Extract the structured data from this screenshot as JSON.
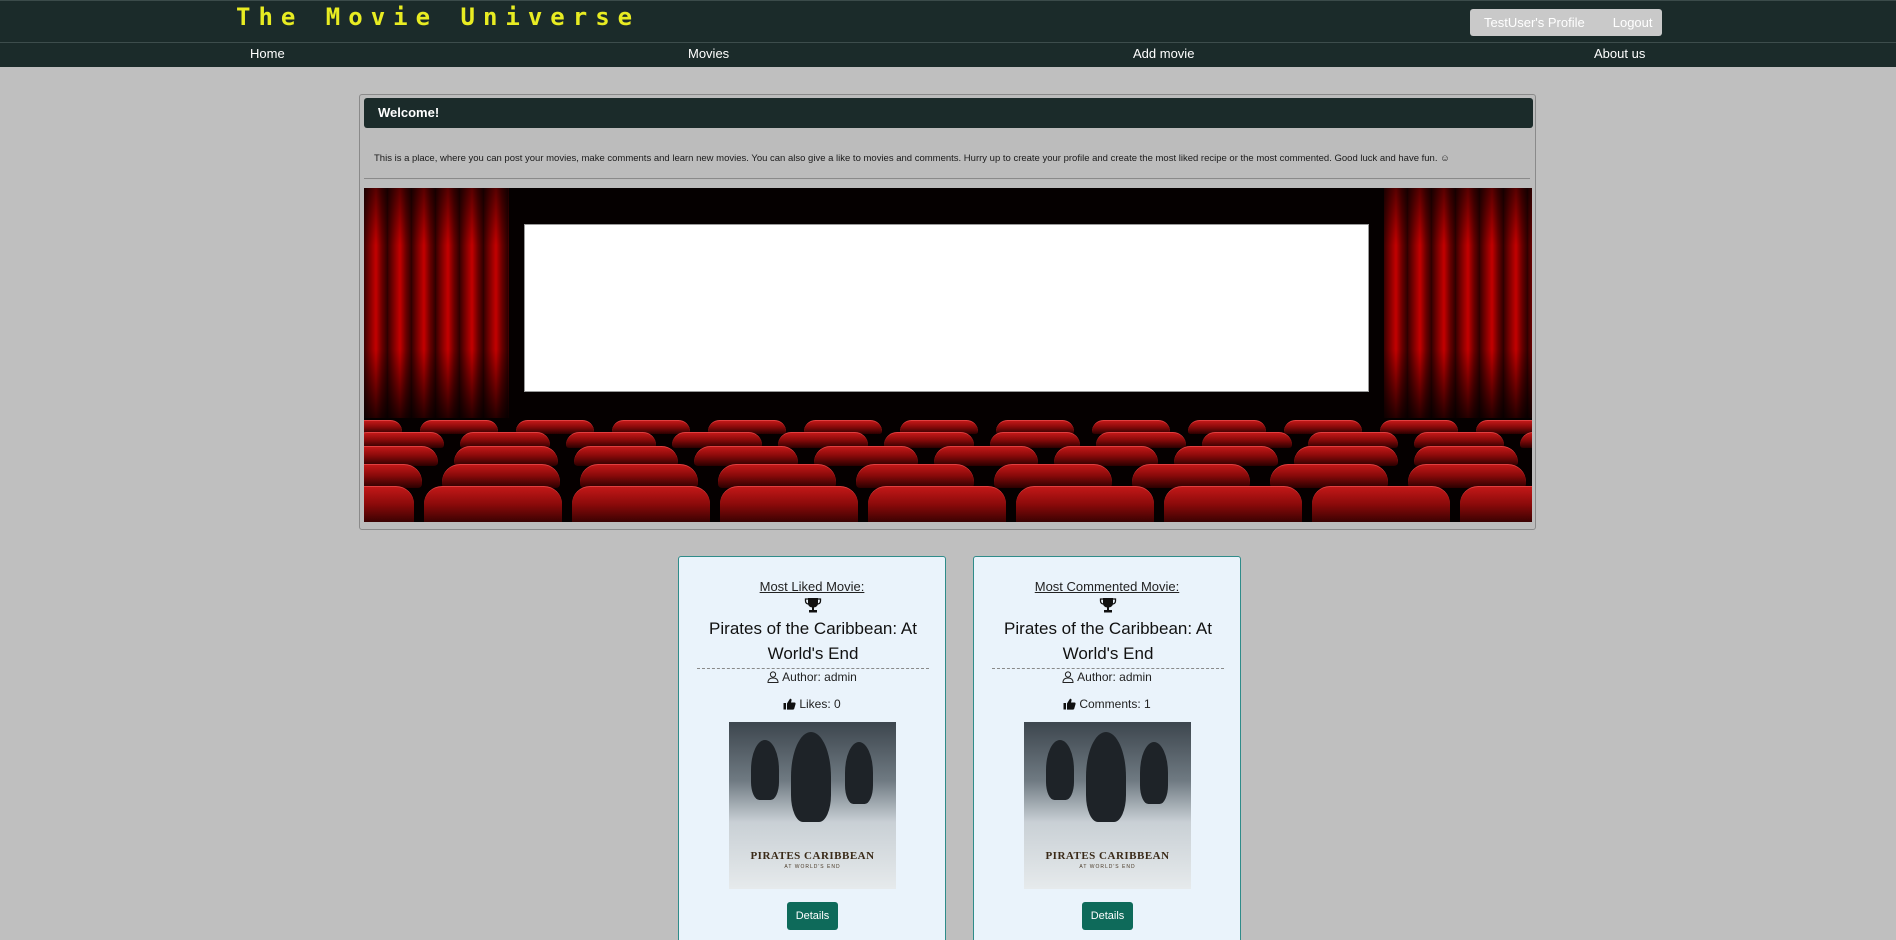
{
  "header": {
    "site_title": "The Movie Universe",
    "profile_link": "TestUser's Profile",
    "logout_link": "Logout"
  },
  "nav": {
    "items": [
      {
        "label": "Home"
      },
      {
        "label": "Movies"
      },
      {
        "label": "Add movie"
      },
      {
        "label": "About us"
      }
    ]
  },
  "welcome": {
    "heading": "Welcome!",
    "text": "This is a place, where you can post your movies, make comments and learn new movies. You can also give a like to movies and comments. Hurry up to create your profile and create the most liked recipe or the most commented. Good luck and have fun. ☺"
  },
  "cards": [
    {
      "label": "Most Liked Movie:",
      "title": "Pirates of the Caribbean: At World's End",
      "author": "Author: admin",
      "stat": "Likes: 0",
      "poster_logo": "PIRATES CARIBBEAN",
      "poster_sub": "AT WORLD'S END",
      "button": "Details"
    },
    {
      "label": "Most Commented Movie:",
      "title": "Pirates of the Caribbean: At World's End",
      "author": "Author: admin",
      "stat": "Comments: 1",
      "poster_logo": "PIRATES CARIBBEAN",
      "poster_sub": "AT WORLD'S END",
      "button": "Details"
    }
  ],
  "icons": {
    "trophy": "trophy-icon",
    "author": "user-icon",
    "stat": "thumbs-up-icon"
  },
  "colors": {
    "header_bg": "#1b2b2a",
    "title_yellow": "#e8ec22",
    "page_bg": "#bfbfbf",
    "card_bg": "#eaf3fb",
    "card_border": "#2f8c8a",
    "button_bg": "#0e6a5a"
  }
}
